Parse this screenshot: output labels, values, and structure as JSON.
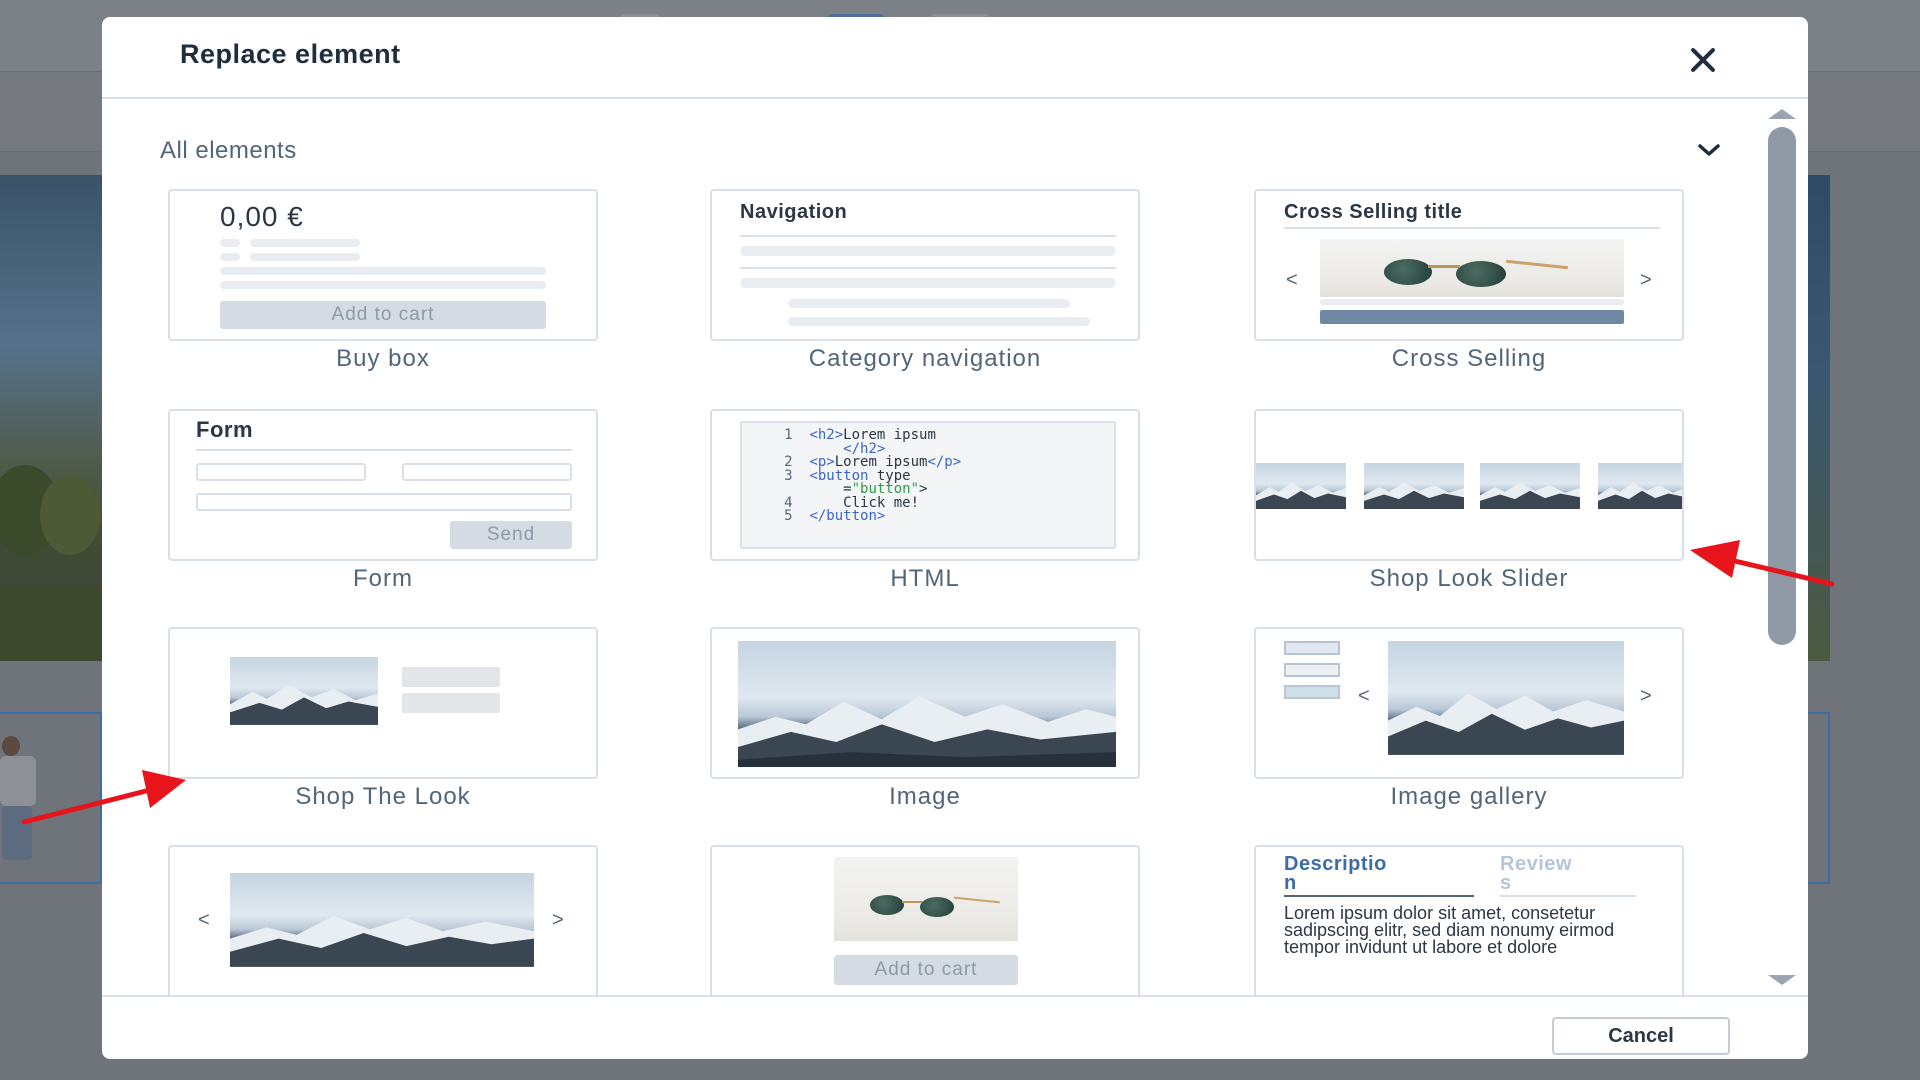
{
  "modal": {
    "title": "Replace element",
    "filter_label": "All elements",
    "cancel_label": "Cancel"
  },
  "tiles": {
    "buy_box": {
      "label": "Buy box",
      "price": "0,00 €",
      "button": "Add to cart"
    },
    "category_navigation": {
      "label": "Category navigation",
      "heading": "Navigation"
    },
    "cross_selling": {
      "label": "Cross Selling",
      "heading": "Cross Selling title",
      "prev": "<",
      "next": ">"
    },
    "form": {
      "label": "Form",
      "heading": "Form",
      "button": "Send"
    },
    "html": {
      "label": "HTML",
      "code": [
        {
          "n": "1",
          "t": "<h2>Lorem ipsum"
        },
        {
          "n": "",
          "t": "    </h2>"
        },
        {
          "n": "2",
          "t": "<p>Lorem ipsum</p>"
        },
        {
          "n": "3",
          "t": "<button type"
        },
        {
          "n": "",
          "t": "    =\"button\">"
        },
        {
          "n": "4",
          "t": "    Click me!"
        },
        {
          "n": "5",
          "t": "</button>"
        }
      ]
    },
    "shop_look_slider": {
      "label": "Shop Look Slider"
    },
    "shop_the_look": {
      "label": "Shop The Look"
    },
    "image": {
      "label": "Image"
    },
    "image_gallery": {
      "label": "Image gallery",
      "prev": "<",
      "next": ">"
    },
    "image_slider": {
      "prev": "<",
      "next": ">"
    },
    "product_box": {
      "button": "Add to cart"
    },
    "product_description": {
      "tab_description": "Descriptio\nn",
      "tab_reviews": "Review\ns",
      "body": "Lorem ipsum dolor sit amet, consetetur sadipscing elitr, sed diam nonumy eirmod tempor invidunt ut labore et dolore"
    }
  },
  "colors": {
    "overlay": "#6f737a",
    "title": "#1f2d3d",
    "muted_text": "#52667a",
    "border": "#d9dfe6",
    "accent_blue": "#3a66c8",
    "annotation_red": "#e8141b"
  },
  "icons": [
    "close-icon",
    "chevron-down-icon",
    "scroll-up-icon",
    "scroll-down-icon"
  ]
}
